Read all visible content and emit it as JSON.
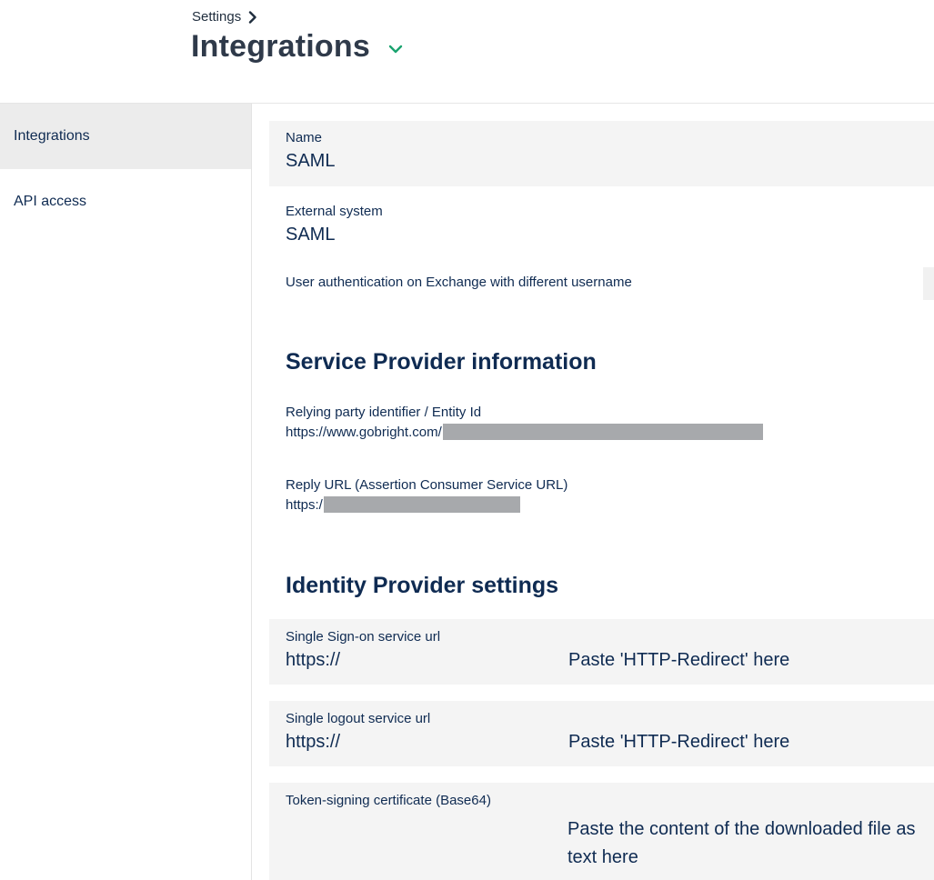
{
  "header": {
    "breadcrumb": "Settings",
    "title": "Integrations"
  },
  "sidebar": {
    "items": [
      {
        "label": "Integrations",
        "active": true
      },
      {
        "label": "API access",
        "active": false
      }
    ]
  },
  "form": {
    "name": {
      "label": "Name",
      "value": "SAML"
    },
    "external_system": {
      "label": "External system",
      "value": "SAML"
    },
    "exchange_auth": {
      "label": "User authentication on Exchange with different username"
    }
  },
  "service_provider": {
    "heading": "Service Provider information",
    "entity_id": {
      "label": "Relying party identifier / Entity Id",
      "value": "https://www.gobright.com/"
    },
    "reply_url": {
      "label": "Reply URL (Assertion Consumer Service URL)",
      "value": "https:/"
    }
  },
  "identity_provider": {
    "heading": "Identity Provider settings",
    "sso_url": {
      "label": "Single Sign-on service url",
      "value": "https://",
      "hint": "Paste 'HTTP-Redirect' here"
    },
    "slo_url": {
      "label": "Single logout service url",
      "value": "https://",
      "hint": "Paste 'HTTP-Redirect' here"
    },
    "cert": {
      "label": "Token-signing certificate (Base64)",
      "hint": "Paste the content of the downloaded file as text here"
    }
  },
  "colors": {
    "primary_text": "#0f2b52",
    "title_text": "#2f3a4a",
    "accent_chevron": "#1aa36f",
    "panel_gray": "#f4f4f4",
    "redaction": "#a7a9ac"
  }
}
